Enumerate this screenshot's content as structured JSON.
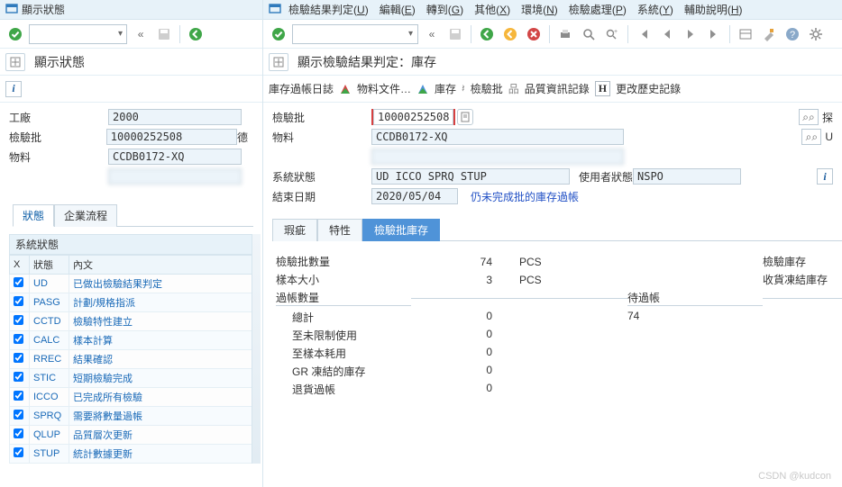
{
  "left": {
    "titlebar": "顯示狀態",
    "apptitle": "顯示狀態",
    "form": {
      "plant_label": "工廠",
      "plant_value": "2000",
      "lot_label": "檢驗批",
      "lot_value": "10000252508",
      "material_label": "物料",
      "material_value": "CCDB0172-XQ",
      "german_label": "德"
    },
    "tabs": {
      "status": "狀態",
      "process": "企業流程"
    },
    "status": {
      "title": "系統狀態",
      "col_chk": "X",
      "col_code": "狀態",
      "col_text": "內文",
      "rows": [
        {
          "code": "UD",
          "text": "已做出檢驗結果判定"
        },
        {
          "code": "PASG",
          "text": "計劃/規格指派"
        },
        {
          "code": "CCTD",
          "text": "檢驗特性建立"
        },
        {
          "code": "CALC",
          "text": "樣本計算"
        },
        {
          "code": "RREC",
          "text": "結果確認"
        },
        {
          "code": "STIC",
          "text": "短期檢驗完成"
        },
        {
          "code": "ICCO",
          "text": "已完成所有檢驗"
        },
        {
          "code": "SPRQ",
          "text": "需要將數量過帳"
        },
        {
          "code": "QLUP",
          "text": "品質層次更新"
        },
        {
          "code": "STUP",
          "text": "統計數據更新"
        }
      ]
    }
  },
  "right": {
    "menu": {
      "ud": "檢驗結果判定",
      "ud_k": "U",
      "edit": "編輯",
      "edit_k": "E",
      "goto": "轉到",
      "goto_k": "G",
      "other": "其他",
      "other_k": "X",
      "env": "環境",
      "env_k": "N",
      "proc": "檢驗處理",
      "proc_k": "P",
      "sys": "系統",
      "sys_k": "Y",
      "help": "輔助說明",
      "help_k": "H"
    },
    "apptitle": "顯示檢驗結果判定：庫存",
    "apptoolbar": {
      "journal": "庫存過帳日誌",
      "matdoc": "物料文件…",
      "stock": "庫存",
      "lot": "檢驗批",
      "qinfo": "品質資訊記錄",
      "history": "更改歷史記錄",
      "history_icon": "H"
    },
    "header": {
      "lot_label": "檢驗批",
      "lot_value": "10000252508",
      "glasses_text": "⌕⌕",
      "explore": "探",
      "un": "U",
      "mat_label": "物料",
      "mat_value": "CCDB0172-XQ",
      "sysstat_label": "系統狀態",
      "sysstat_value": "UD  ICCO SPRQ STUP",
      "userstat_label": "使用者狀態",
      "userstat_value": "NSPO",
      "end_label": "結束日期",
      "end_value": "2020/05/04",
      "note": "仍未完成批的庫存過帳"
    },
    "tabs": {
      "defects": "瑕疵",
      "chars": "特性",
      "lotstock": "檢驗批庫存"
    },
    "stock": {
      "lotqty": "檢驗批數量",
      "lotqty_v": "74",
      "uom_pcs": "PCS",
      "sample": "樣本大小",
      "sample_v": "3",
      "insp_stock": "檢驗庫存",
      "gr_frz_stock": "收貨凍結庫存",
      "postings": "過帳數量",
      "to_post": "待過帳",
      "to_post_v": "74",
      "rows": {
        "total": "總計",
        "total_v": "0",
        "unrestricted": "至未限制使用",
        "unrestricted_v": "0",
        "sample_use": "至樣本耗用",
        "sample_use_v": "0",
        "gr_frozen": "GR 凍結的庫存",
        "gr_frozen_v": "0",
        "return_post": "退貨過帳",
        "return_post_v": "0"
      }
    }
  },
  "watermark": "CSDN @kudcon"
}
